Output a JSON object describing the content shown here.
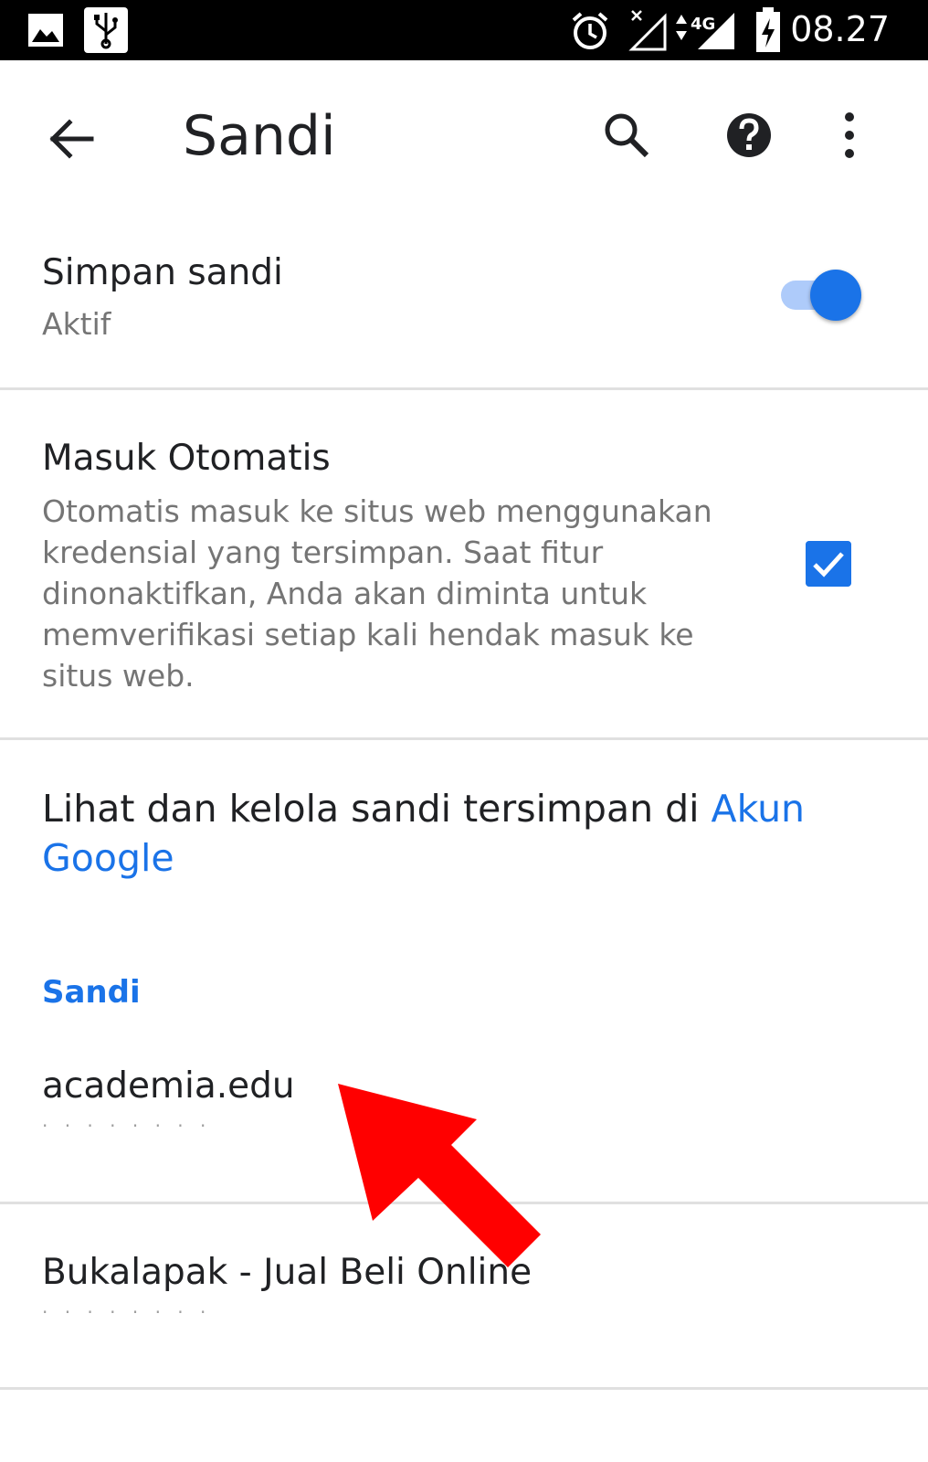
{
  "status_bar": {
    "time": "08.27",
    "icons": [
      "image-icon",
      "usb-icon",
      "alarm-icon",
      "signal-4g-icon",
      "battery-charging-icon"
    ],
    "network_label": "4G"
  },
  "app_bar": {
    "title": "Sandi",
    "icons": [
      "back-arrow-icon",
      "search-icon",
      "help-icon",
      "more-vert-icon"
    ]
  },
  "settings": {
    "save_passwords": {
      "title": "Simpan sandi",
      "subtitle": "Aktif",
      "enabled": true
    },
    "auto_signin": {
      "title": "Masuk Otomatis",
      "description": "Otomatis masuk ke situs web menggunakan kredensial yang tersimpan. Saat fitur dinonaktifkan, Anda akan diminta untuk memverifikasi setiap kali hendak masuk ke situs web.",
      "checked": true
    },
    "manage_link": {
      "text": "Lihat dan kelola sandi tersimpan di ",
      "link_text": "Akun Google"
    }
  },
  "passwords_section": {
    "header": "Sandi",
    "items": [
      {
        "site": "academia.edu",
        "username_masked": "· · · · · ·  · ·"
      },
      {
        "site": "Bukalapak - Jual Beli Online",
        "username_masked": "· · · · · ·  · ·"
      }
    ]
  },
  "colors": {
    "accent": "#1a73e8",
    "annotation_arrow": "#ff0000"
  }
}
